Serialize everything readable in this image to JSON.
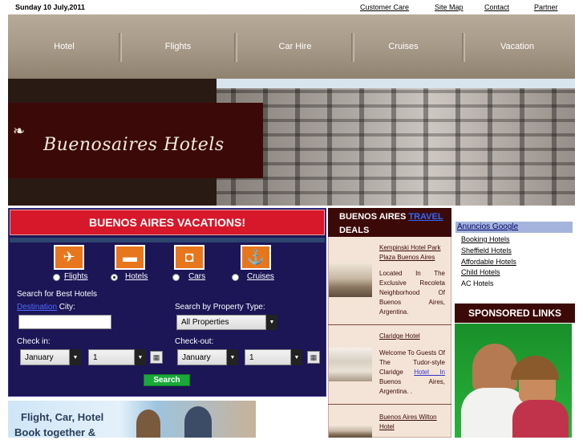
{
  "topbar": {
    "date": "Sunday 10 July,2011",
    "links": [
      "Customer Care",
      "Site Map",
      "Contact",
      "Partner"
    ]
  },
  "nav": {
    "items": [
      "Hotel",
      "Flights",
      "Car Hire",
      "Cruises",
      "Vacation"
    ]
  },
  "banner": {
    "logo_text": "Buenosaires Hotels"
  },
  "vacations": {
    "title": "BUENOS AIRES VACATIONS!",
    "options": [
      {
        "label": "Flights",
        "icon": "airplane-icon",
        "selected": false
      },
      {
        "label": "Hotels",
        "icon": "bed-icon",
        "selected": true
      },
      {
        "label": "Cars",
        "icon": "car-icon",
        "selected": false
      },
      {
        "label": "Cruises",
        "icon": "ship-icon",
        "selected": false
      }
    ],
    "search_label": "Search for Best Hotels",
    "destination_link": "Destination",
    "city_label": " City:",
    "city_value": "",
    "property_label": "Search by Property Type:",
    "property_value": "All Properties",
    "checkin_label": "Check in:",
    "checkout_label": "Check-out:",
    "checkin_month": "January",
    "checkin_day": "1",
    "checkout_month": "January",
    "checkout_day": "1",
    "search_button": "Search",
    "accent_color": "#d7182a",
    "panel_color": "#1c1556"
  },
  "promo": {
    "line1": "Flight, Car, Hotel",
    "line2": "Book together &"
  },
  "deals": {
    "title_part1": "BUENOS AIRES ",
    "title_link": "TRAVEL",
    "title_part2": "DEALS",
    "items": [
      {
        "name": "Kempinski Hotel Park Plaza Buenos Aires",
        "description": "Located In The Exclusive Recoleta Neighborhood Of Buenos Aires, Argentina."
      },
      {
        "name": "Claridge Hotel",
        "description_pre": "Welcome To Guests Of The Tudor-style Claridge",
        "description_link": "Hotel In",
        "description_post": "Buenos Aires, Argentina. ."
      },
      {
        "name": "Buenos Aires Wilton Hotel"
      }
    ]
  },
  "ads": {
    "title": "Anuncios Google",
    "links": [
      "Booking Hotels",
      "Sheffield Hotels",
      "Affordable Hotels",
      "Child Hotels",
      "AC Hotels"
    ]
  },
  "sponsored": {
    "title": "SPONSORED LINKS"
  }
}
